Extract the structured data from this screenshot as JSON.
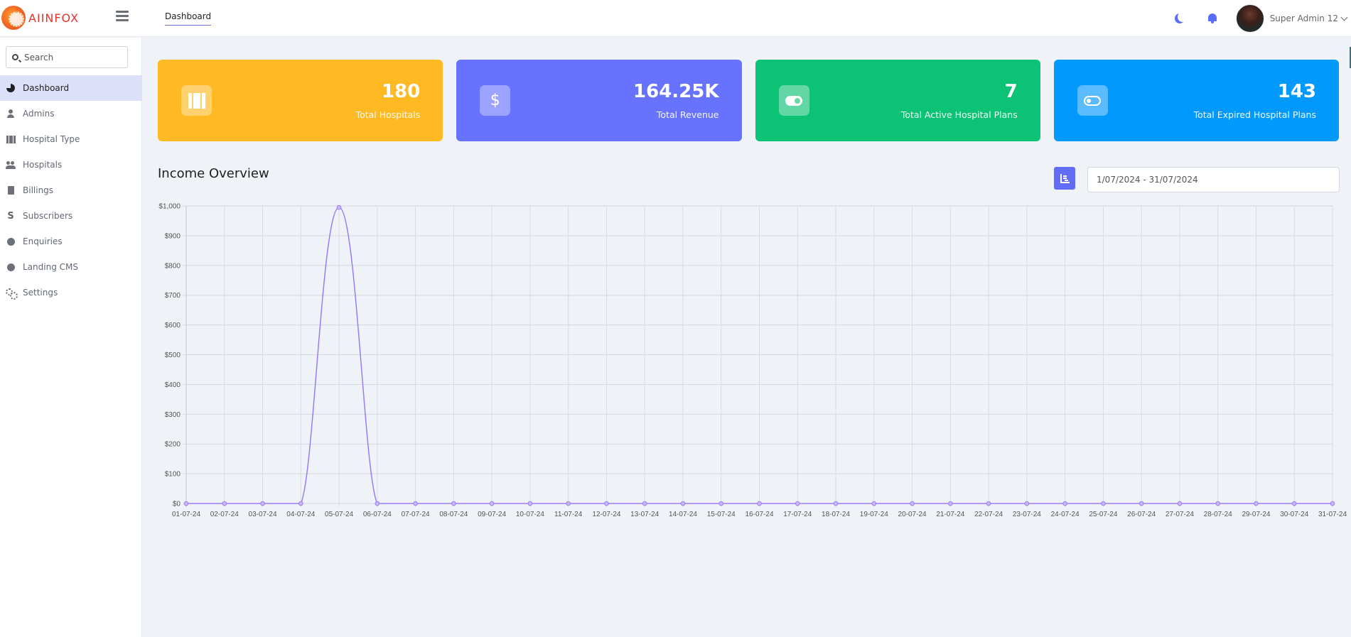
{
  "brand": {
    "logo_text": "AIINFOX"
  },
  "header": {
    "tabs": [
      {
        "label": "Dashboard",
        "active": true
      }
    ],
    "icons": {
      "theme": "moon-icon",
      "notifications": "bell-icon"
    },
    "user": {
      "name": "Super Admin 12"
    }
  },
  "sidebar": {
    "search": {
      "placeholder": "Search",
      "value": ""
    },
    "items": [
      {
        "label": "Dashboard",
        "icon": "pie-chart-icon",
        "active": true
      },
      {
        "label": "Admins",
        "icon": "user-icon",
        "active": false
      },
      {
        "label": "Hospital Type",
        "icon": "building-icon",
        "active": false
      },
      {
        "label": "Hospitals",
        "icon": "users-icon",
        "active": false
      },
      {
        "label": "Billings",
        "icon": "file-invoice-icon",
        "active": false
      },
      {
        "label": "Subscribers",
        "icon": "dollar-s-icon",
        "active": false
      },
      {
        "label": "Enquiries",
        "icon": "enquiry-icon",
        "active": false
      },
      {
        "label": "Landing CMS",
        "icon": "gear-icon",
        "active": false
      },
      {
        "label": "Settings",
        "icon": "gears-icon",
        "active": false
      }
    ]
  },
  "cards": [
    {
      "value": "180",
      "label": "Total Hospitals",
      "icon": "hospital-icon",
      "color": "#ffb923"
    },
    {
      "value": "164.25K",
      "label": "Total Revenue",
      "icon": "dollar-icon",
      "color": "#6772fe"
    },
    {
      "value": "7",
      "label": "Total Active Hospital Plans",
      "icon": "toggle-on-icon",
      "color": "#0bc275"
    },
    {
      "value": "143",
      "label": "Total Expired Hospital Plans",
      "icon": "toggle-off-icon",
      "color": "#0299fd"
    }
  ],
  "income": {
    "title": "Income Overview",
    "date_range": "1/07/2024 - 31/07/2024",
    "chart_button_icon": "chart-bar-icon"
  },
  "chart_data": {
    "type": "line",
    "title": "Income Overview",
    "xlabel": "",
    "ylabel": "",
    "x": [
      "01-07-24",
      "02-07-24",
      "03-07-24",
      "04-07-24",
      "05-07-24",
      "06-07-24",
      "07-07-24",
      "08-07-24",
      "09-07-24",
      "10-07-24",
      "11-07-24",
      "12-07-24",
      "13-07-24",
      "14-07-24",
      "15-07-24",
      "16-07-24",
      "17-07-24",
      "18-07-24",
      "19-07-24",
      "20-07-24",
      "21-07-24",
      "22-07-24",
      "23-07-24",
      "24-07-24",
      "25-07-24",
      "26-07-24",
      "27-07-24",
      "28-07-24",
      "29-07-24",
      "30-07-24",
      "31-07-24"
    ],
    "series": [
      {
        "name": "Income",
        "color": "#9b7cf4",
        "values": [
          0,
          0,
          0,
          0,
          995,
          0,
          0,
          0,
          0,
          0,
          0,
          0,
          0,
          0,
          0,
          0,
          0,
          0,
          0,
          0,
          0,
          0,
          0,
          0,
          0,
          0,
          0,
          0,
          0,
          0,
          0
        ]
      }
    ],
    "ylim": [
      0,
      1000
    ],
    "yticks": [
      0,
      100,
      200,
      300,
      400,
      500,
      600,
      700,
      800,
      900,
      1000
    ],
    "ytick_labels": [
      "$0",
      "$100",
      "$200",
      "$300",
      "$400",
      "$500",
      "$600",
      "$700",
      "$800",
      "$900",
      "$1,000"
    ],
    "grid": true,
    "legend": "none"
  }
}
